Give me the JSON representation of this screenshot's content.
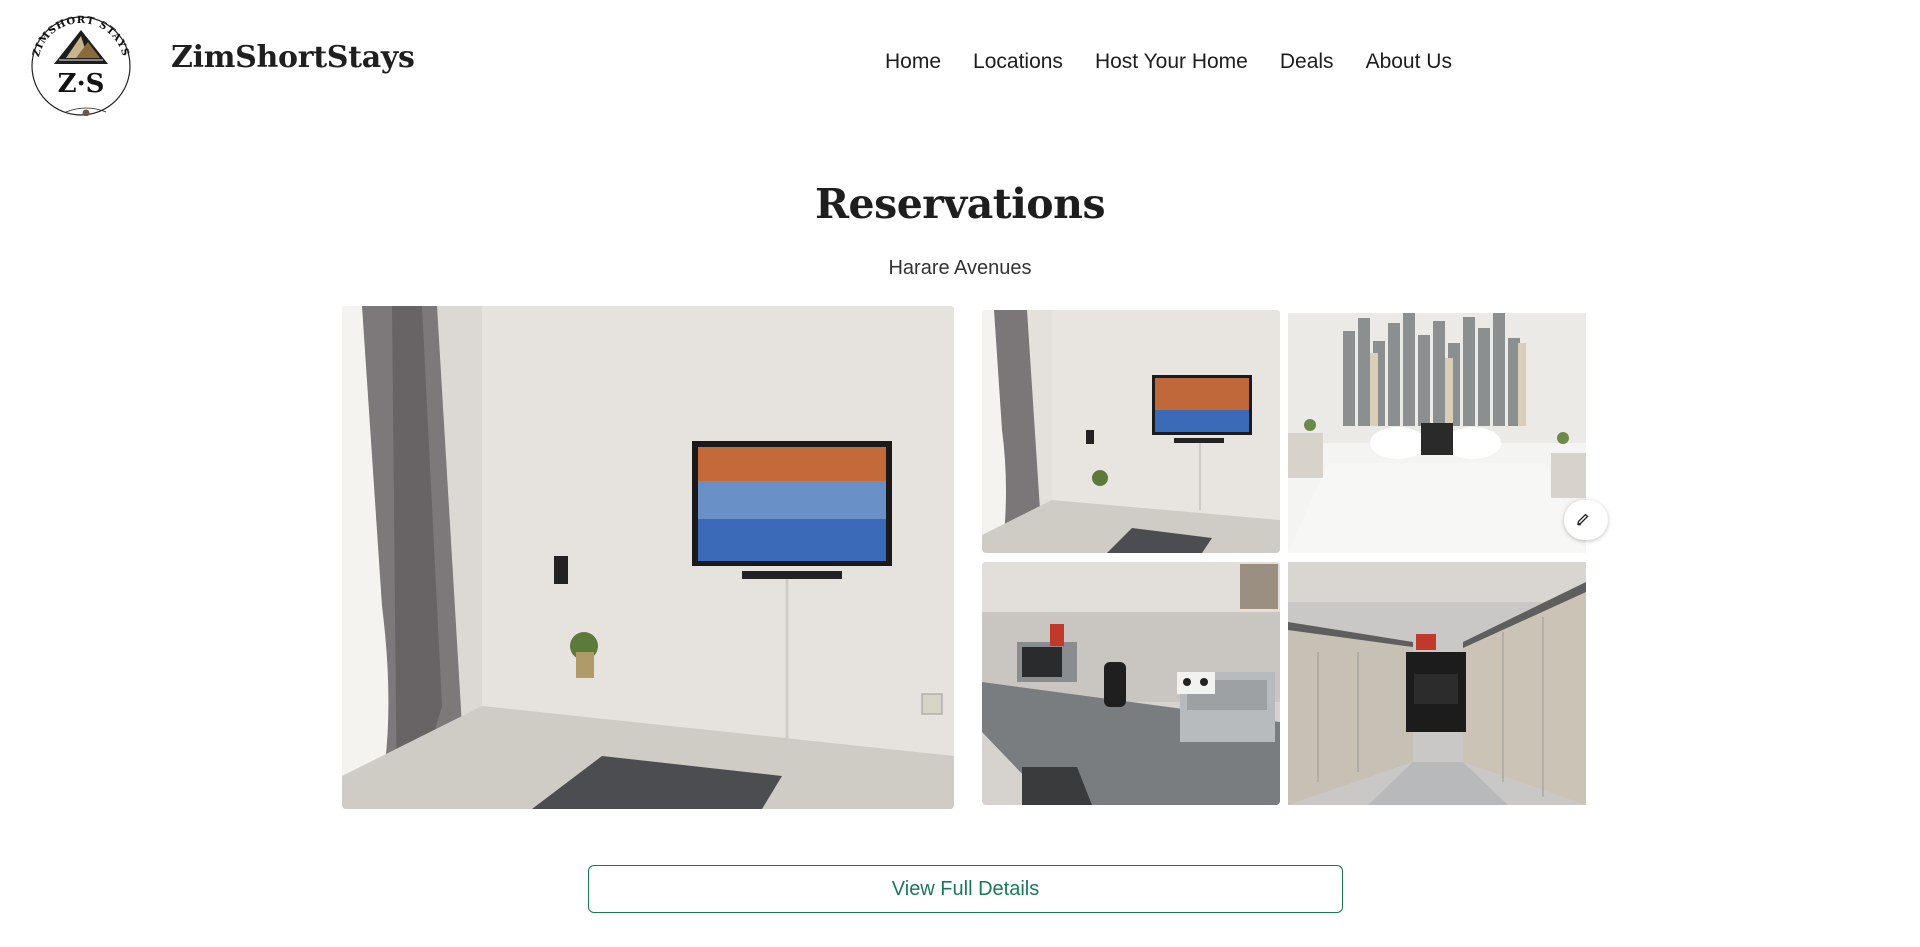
{
  "header": {
    "brand_name": "ZimShortStays",
    "logo_top_text": "ZIMSHORT STAYS",
    "logo_monogram": "Z·S",
    "nav": [
      {
        "label": "Home"
      },
      {
        "label": "Locations"
      },
      {
        "label": "Host Your Home"
      },
      {
        "label": "Deals"
      },
      {
        "label": "About Us"
      }
    ]
  },
  "main": {
    "title": "Reservations",
    "location": "Harare Avenues",
    "gallery": {
      "main_image": "living-room-tv-photo",
      "thumbnails": [
        {
          "image": "living-room-tv-photo"
        },
        {
          "image": "bedroom-photo"
        },
        {
          "image": "kitchen-counter-photo"
        },
        {
          "image": "kitchen-stove-photo"
        }
      ],
      "edit_icon": "pencil-icon"
    },
    "details_button": "View Full Details"
  },
  "colors": {
    "accent": "#1a7a55",
    "text": "#1e1e1e"
  }
}
